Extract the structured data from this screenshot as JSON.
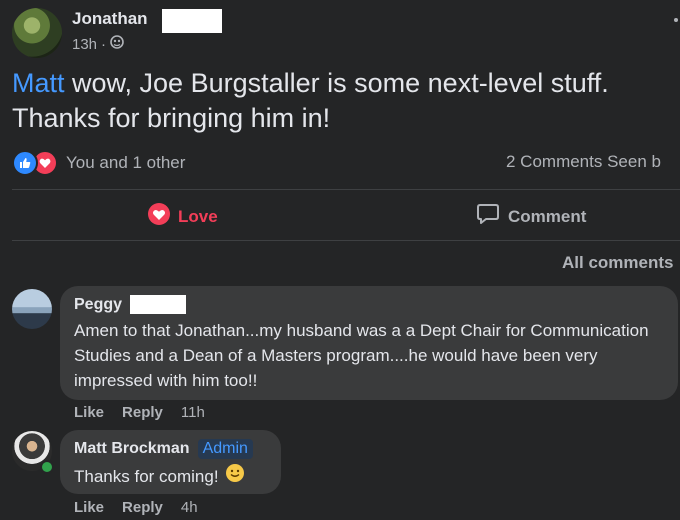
{
  "post": {
    "author": "Jonathan",
    "time": "13h",
    "privacy_icon": "friends-globe-icon",
    "mention": "Matt",
    "text": " wow, Joe Burgstaller is some next-level stuff. Thanks for bringing him in!",
    "reactions_text": "You and 1 other",
    "stats": "2 Comments  Seen b",
    "love_label": "Love",
    "comment_label": "Comment"
  },
  "comments_filter": "All comments",
  "comments": [
    {
      "name": "Peggy",
      "text": "Amen to that Jonathan...my husband was a a Dept Chair for Communication Studies and a Dean of a Masters program....he would have been very impressed with him too!!",
      "like": "Like",
      "reply": "Reply",
      "time": "11h"
    },
    {
      "name": "Matt Brockman",
      "badge": "Admin",
      "text": "Thanks for coming!",
      "like": "Like",
      "reply": "Reply",
      "time": "4h"
    }
  ],
  "colors": {
    "background": "#242526",
    "bubble": "#3a3b3c",
    "mention": "#4599ff",
    "love": "#f33e58",
    "like": "#2e89ff",
    "online": "#31a24c"
  }
}
